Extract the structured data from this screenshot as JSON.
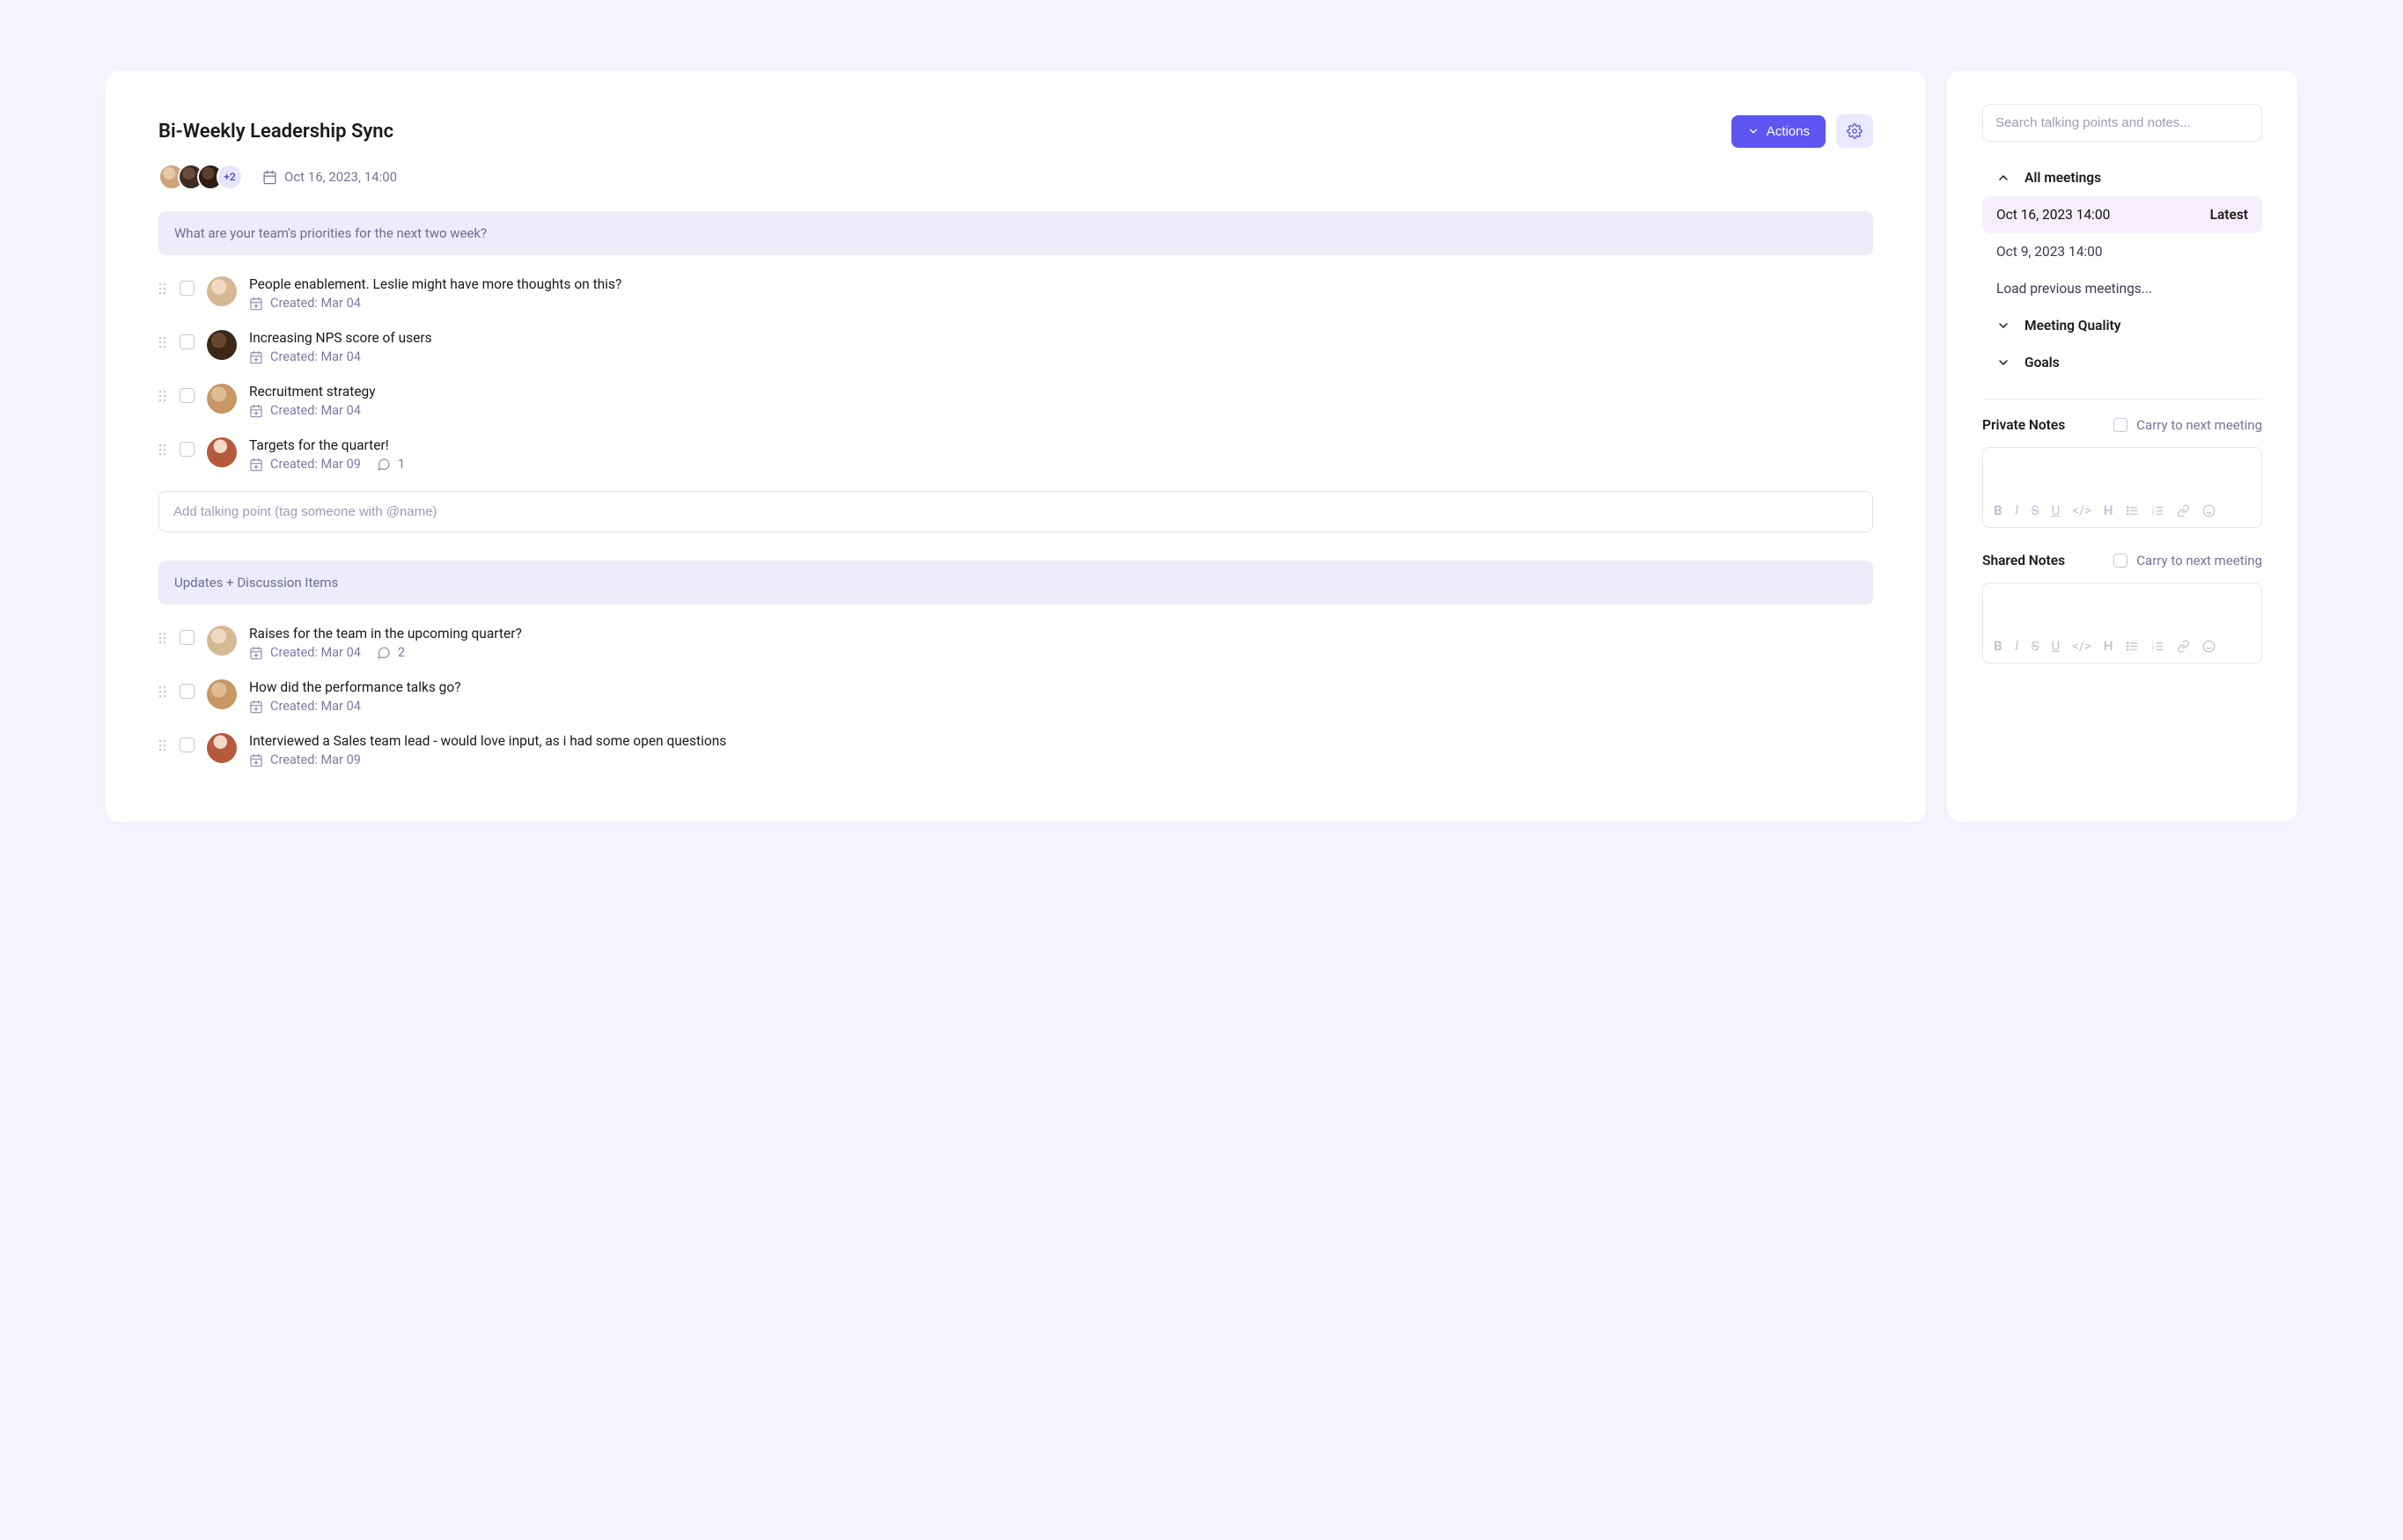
{
  "header": {
    "title": "Bi-Weekly Leadership Sync",
    "actions_label": "Actions",
    "avatar_more": "+2",
    "date": "Oct 16, 2023, 14:00"
  },
  "sections": {
    "priorities_prompt": "What are your team's priorities for the next two week?",
    "updates_prompt": "Updates + Discussion Items",
    "add_placeholder": "Add talking point (tag someone with @name)"
  },
  "priority_items": [
    {
      "title": "People enablement. Leslie might have more thoughts on this?",
      "created": "Created: Mar 04",
      "comments": null,
      "avatar": "av-4"
    },
    {
      "title": "Increasing NPS score of users",
      "created": "Created: Mar 04",
      "comments": null,
      "avatar": "av-5"
    },
    {
      "title": "Recruitment strategy",
      "created": "Created: Mar 04",
      "comments": null,
      "avatar": "av-6"
    },
    {
      "title": "Targets for the quarter!",
      "created": "Created: Mar 09",
      "comments": "1",
      "avatar": "av-7"
    }
  ],
  "update_items": [
    {
      "title": "Raises for the team in the upcoming quarter?",
      "created": "Created: Mar 04",
      "comments": "2",
      "avatar": "av-4"
    },
    {
      "title": "How did the performance talks go?",
      "created": "Created: Mar 04",
      "comments": null,
      "avatar": "av-6"
    },
    {
      "title": "Interviewed a Sales team lead - would love input, as i had some open questions",
      "created": "Created: Mar 09",
      "comments": null,
      "avatar": "av-7"
    }
  ],
  "sidebar": {
    "search_placeholder": "Search talking points and notes...",
    "all_meetings": "All meetings",
    "meetings": [
      {
        "label": "Oct 16, 2023 14:00",
        "badge": "Latest",
        "selected": true
      },
      {
        "label": "Oct 9, 2023 14:00",
        "badge": null,
        "selected": false
      }
    ],
    "load_prev": "Load previous meetings...",
    "meeting_quality": "Meeting Quality",
    "goals": "Goals",
    "private_notes": "Private Notes",
    "shared_notes": "Shared Notes",
    "carry_label": "Carry to next meeting"
  }
}
